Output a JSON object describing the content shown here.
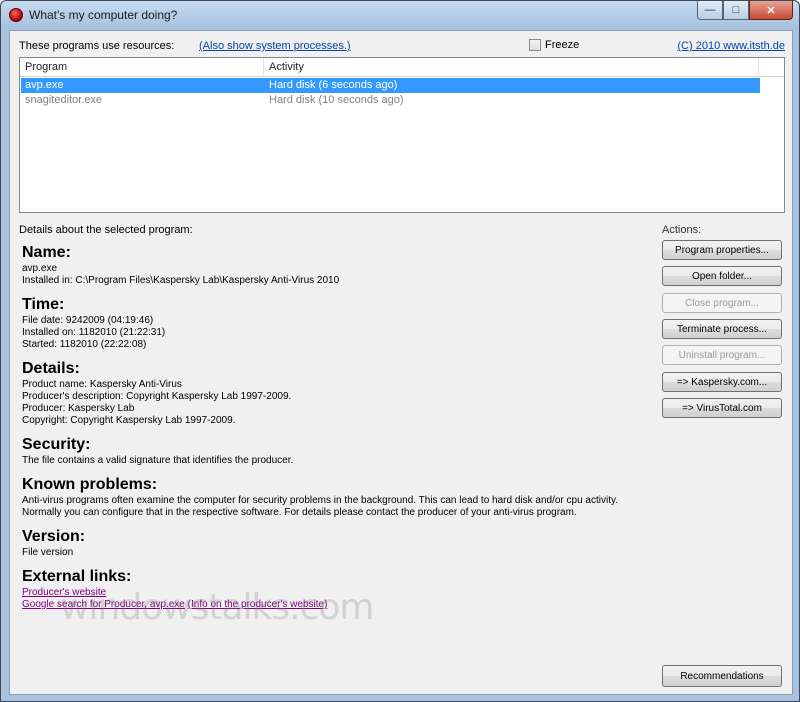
{
  "window": {
    "title": "What's my computer doing?",
    "caption": {
      "minimize": "—",
      "maximize": "□",
      "close": "✕"
    }
  },
  "toprow": {
    "label": "These programs use resources:",
    "show_system": "(Also show system processes.)",
    "freeze": "Freeze",
    "copyright": "(C) 2010 www.itsth.de"
  },
  "list": {
    "columns": [
      "Program",
      "Activity"
    ],
    "rows": [
      {
        "program": "avp.exe",
        "activity": "Hard disk (6 seconds ago)",
        "selected": true
      },
      {
        "program": "snagiteditor.exe",
        "activity": "Hard disk (10 seconds ago)",
        "selected": false
      }
    ]
  },
  "details": {
    "label": "Details about the selected program:",
    "name": {
      "heading": "Name:",
      "lines": [
        "avp.exe",
        "Installed in: C:\\Program Files\\Kaspersky Lab\\Kaspersky Anti-Virus 2010"
      ]
    },
    "time": {
      "heading": "Time:",
      "lines": [
        "File date: 9242009 (04:19:46)",
        "Installed on: 1182010 (21:22:31)",
        "Started: 1182010 (22:22:08)"
      ]
    },
    "info": {
      "heading": "Details:",
      "lines": [
        "Product name: Kaspersky Anti-Virus",
        "Producer's description: Copyright Kaspersky Lab 1997-2009.",
        "Producer: Kaspersky Lab",
        "Copyright: Copyright Kaspersky Lab 1997-2009."
      ]
    },
    "security": {
      "heading": "Security:",
      "lines": [
        "The file contains a valid signature that identifies the producer."
      ]
    },
    "problems": {
      "heading": "Known problems:",
      "lines": [
        "Anti-virus programs often examine the computer for security problems in the background. This can lead to hard disk and/or cpu activity.",
        "Normally you can configure that in the respective software. For details please contact the producer of your anti-virus program."
      ]
    },
    "version": {
      "heading": "Version:",
      "lines": [
        "File version"
      ]
    },
    "links": {
      "heading": "External links:",
      "producer_site": "Producer's website",
      "google_search": "Google search for Producer, avp.exe",
      "info_site": "(Info on the producer's website)"
    }
  },
  "actions": {
    "label": "Actions:",
    "buttons": [
      {
        "label": "Program properties...",
        "enabled": true
      },
      {
        "label": "Open folder...",
        "enabled": true
      },
      {
        "label": "Close program...",
        "enabled": false
      },
      {
        "label": "Terminate process...",
        "enabled": true
      },
      {
        "label": "Uninstall program...",
        "enabled": false
      },
      {
        "label": "=> Kaspersky.com...",
        "enabled": true
      },
      {
        "label": "=> VirusTotal.com",
        "enabled": true
      }
    ],
    "recommendations": "Recommendations"
  },
  "watermark": "windowstalks.com"
}
